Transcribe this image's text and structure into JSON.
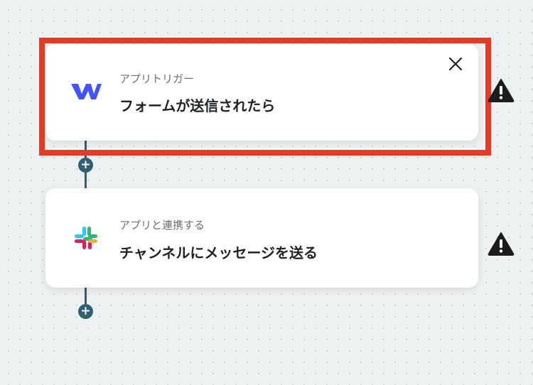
{
  "flow": {
    "steps": [
      {
        "app": "webflow",
        "app_icon": "webflow-logo-icon",
        "subtitle": "アプリトリガー",
        "title": "フォームが送信されたら",
        "selected": true,
        "warning_icon": "warning-triangle-icon"
      },
      {
        "app": "slack",
        "app_icon": "slack-logo-icon",
        "subtitle": "アプリと連携する",
        "title": "チャンネルにメッセージを送る",
        "selected": false,
        "warning_icon": "warning-triangle-icon"
      }
    ],
    "add_step_symbol": "+",
    "close_icon": "close-icon"
  },
  "colors": {
    "canvas_bg": "#eef1f2",
    "connector": "#2f5f73",
    "highlight": "#e53a23",
    "webflow_blue": "#4353ff",
    "warning": "#1c1c1c"
  }
}
